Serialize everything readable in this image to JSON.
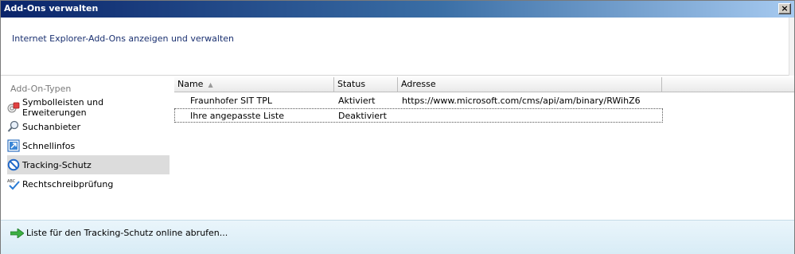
{
  "window": {
    "title": "Add-Ons verwalten",
    "close_label": "×"
  },
  "header": {
    "subtitle": "Internet Explorer-Add-Ons anzeigen und verwalten"
  },
  "sidebar": {
    "heading": "Add-On-Typen",
    "items": [
      {
        "label": "Symbolleisten und Erweiterungen",
        "icon": "gear-puzzle-icon",
        "selected": false
      },
      {
        "label": "Suchanbieter",
        "icon": "search-icon",
        "selected": false
      },
      {
        "label": "Schnellinfos",
        "icon": "accelerator-icon",
        "selected": false
      },
      {
        "label": "Tracking-Schutz",
        "icon": "no-entry-icon",
        "selected": true
      },
      {
        "label": "Rechtschreibprüfung",
        "icon": "spellcheck-icon",
        "selected": false
      }
    ]
  },
  "list": {
    "columns": [
      "Name",
      "Status",
      "Adresse"
    ],
    "sort_indicator": "▲",
    "rows": [
      {
        "name": "Fraunhofer SIT TPL",
        "status": "Aktiviert",
        "address": "https://www.microsoft.com/cms/api/am/binary/RWihZ6"
      },
      {
        "name": "Ihre angepasste Liste",
        "status": "Deaktiviert",
        "address": ""
      }
    ]
  },
  "footer": {
    "link_label": "Liste für den Tracking-Schutz online abrufen..."
  },
  "colors": {
    "title_gradient_start": "#0a246a",
    "title_gradient_end": "#a6caf0",
    "subtitle": "#1a3070",
    "selected_bg": "#dcdcdc",
    "footer_bg": "#eaf5fb"
  }
}
